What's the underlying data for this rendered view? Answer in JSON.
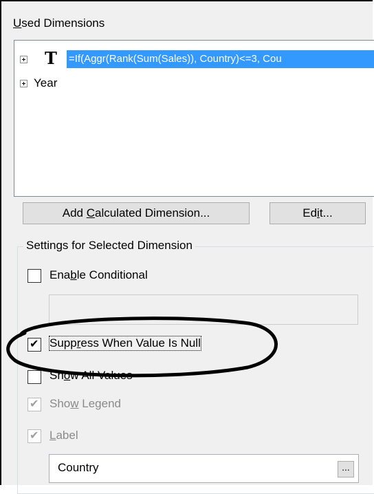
{
  "used_dimensions": {
    "title_accel": "U",
    "title_rest": "sed Dimensions",
    "items": [
      {
        "text": "=If(Aggr(Rank(Sum(Sales)), Country)<=3, Cou",
        "icon": "T",
        "selected": true
      },
      {
        "text": "Year",
        "selected": false
      }
    ]
  },
  "buttons": {
    "add_calc_a": "Add ",
    "add_calc_accel": "C",
    "add_calc_b": "alculated Dimension...",
    "edit_a": "Ed",
    "edit_accel": "i",
    "edit_b": "t..."
  },
  "settings": {
    "group_title": "Settings for Selected Dimension",
    "enable_conditional": {
      "a": "Ena",
      "accel": "b",
      "b": "le Conditional",
      "checked": false
    },
    "suppress_null": {
      "a": "Supp",
      "accel": "r",
      "b": "ess When Value Is Null",
      "checked": true
    },
    "show_all_values": {
      "a": "Sh",
      "accel": "o",
      "b": "w All Values",
      "checked": false
    },
    "show_legend": {
      "a": "Sho",
      "accel": "w",
      "b": " Legend",
      "checked": true
    },
    "label": {
      "accel": "L",
      "b": "abel",
      "checked": true,
      "value": "Country"
    },
    "dots_label": "..."
  },
  "colors": {
    "selection": "#3399ff",
    "panel": "#f0f0f0"
  }
}
